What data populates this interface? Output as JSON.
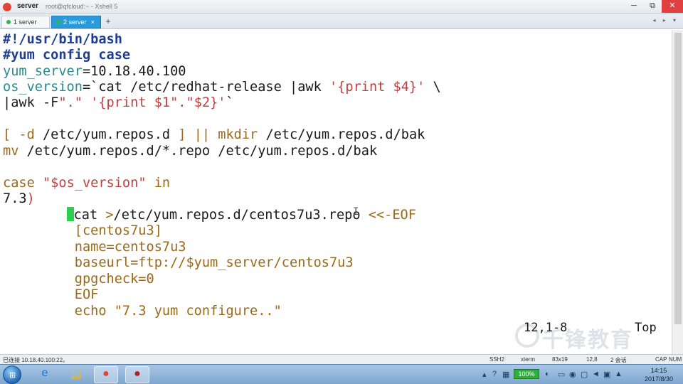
{
  "window": {
    "title": "server",
    "path": "root@qfcloud:~ - Xshell 5",
    "controls": {
      "minimize": "─",
      "maximize": "⧉",
      "close": "✕"
    }
  },
  "tabs": [
    {
      "label": "1 server",
      "active": false
    },
    {
      "label": "2 server",
      "active": true
    }
  ],
  "tab_add": "+",
  "tab_nav": "◂ ▸ ▾",
  "terminal": {
    "lines": [
      {
        "text": "#!/usr/bin/bash"
      },
      {
        "text": "#yum config case"
      },
      {
        "var": "yum_server",
        "rest": "=10.18.40.100"
      },
      {
        "var": "os_version",
        "eq": "=`",
        "rest": "cat /etc/redhat-release |awk ",
        "str": "'{print $4}'",
        "tail": " \\"
      },
      {
        "a": "|awk -F",
        "s1": "\".\"",
        "b": " ",
        "s2": "'{print $1\".\"$2}'",
        "tail": "`"
      },
      {
        "text": ""
      },
      {
        "a": "[ -d ",
        "b": "/etc/yum.repos.d",
        "c": " ] || ",
        "d": "mkdir",
        "e": " /etc/yum.repos.d/bak"
      },
      {
        "a": "mv",
        "b": " /etc/yum.repos.d/*.repo /etc/yum.repos.d/bak"
      },
      {
        "text": ""
      },
      {
        "kw": "case",
        "sp": " ",
        "str": "\"$os_version\"",
        "in": " in"
      },
      {
        "a": "7.3",
        "b": ")"
      },
      {
        "a": "cat ",
        "b": ">",
        "c": "/etc/yum.repos.d/centos7u3.repo ",
        "d": "<<-EOF"
      },
      {
        "text": "[centos7u3]"
      },
      {
        "text": "name=centos7u3"
      },
      {
        "text": "baseurl=ftp://$yum_server/centos7u3"
      },
      {
        "text": "gpgcheck=0"
      },
      {
        "text": "EOF"
      },
      {
        "a": "echo ",
        "b": "\"7.3 yum configure..\""
      }
    ],
    "ruler": "12,1-8",
    "position": "Top",
    "ibeam": "I"
  },
  "watermark": {
    "text": "千锋教育"
  },
  "statusbar": {
    "connected": "已连接 10.18.40.100:22。",
    "protocol": "SSH2",
    "term": "xterm",
    "size": "83x19",
    "cursor": "12,8",
    "sessions": "2 会话",
    "caps": "CAP",
    "num": "NUM"
  },
  "taskbar": {
    "battery": "100%",
    "time": "14:15",
    "date": "2017/8/30"
  },
  "colors": {
    "comment": "#1f3d8f",
    "variable": "#2a8a8f",
    "string": "#c04040",
    "cursor": "#2ecf4e",
    "active_tab": "#2b9ad8"
  }
}
